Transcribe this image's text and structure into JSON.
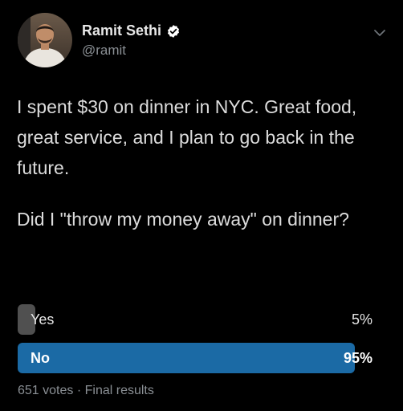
{
  "colors": {
    "background": "#000000",
    "bar_leading": "#1b6aa5",
    "bar_other": "#505050",
    "verified_badge": "#ffffff",
    "muted_text": "#8a8f94"
  },
  "author": {
    "name": "Ramit Sethi",
    "handle": "@ramit",
    "verified": true
  },
  "tweet": {
    "paragraph_1": "I spent $30 on dinner in NYC. Great food, great service, and I plan to go back in the future.",
    "paragraph_2": "Did I \"throw my money away\" on dinner?"
  },
  "poll": {
    "options": [
      {
        "label": "Yes",
        "percent_text": "5%",
        "percent": 5
      },
      {
        "label": "No",
        "percent_text": "95%",
        "percent": 95
      }
    ],
    "votes_text": "651 votes",
    "separator": "·",
    "status_text": "Final results"
  },
  "icons": {
    "verified": "verified-badge-icon",
    "menu": "chevron-down-icon"
  }
}
